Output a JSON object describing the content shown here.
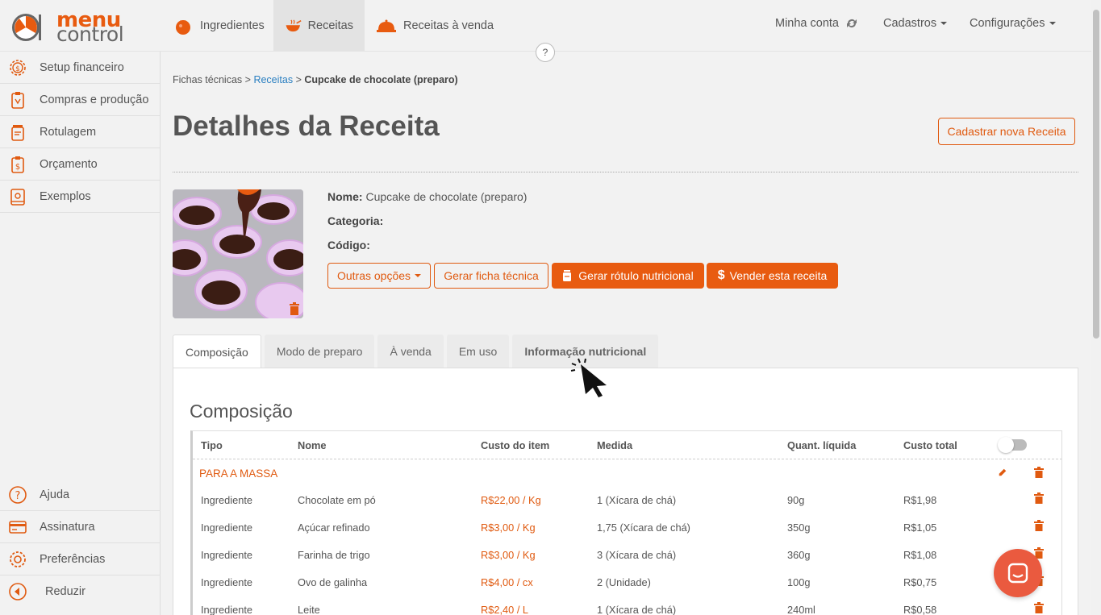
{
  "brand": {
    "line1": "menu",
    "line2": "control",
    "accent": "#e85b10"
  },
  "topnav": {
    "items": [
      {
        "label": "Ingredientes",
        "icon": "tomato-icon"
      },
      {
        "label": "Receitas",
        "icon": "bowl-icon",
        "active": true
      },
      {
        "label": "Receitas à venda",
        "icon": "cloche-icon"
      }
    ],
    "account": "Minha conta",
    "cadastros": "Cadastros",
    "config": "Configurações",
    "help": "?"
  },
  "sidebar": {
    "items": [
      {
        "label": "Setup financeiro",
        "icon": "gear-dollar-icon"
      },
      {
        "label": "Compras e produção",
        "icon": "clipboard-icon"
      },
      {
        "label": "Rotulagem",
        "icon": "jar-icon"
      },
      {
        "label": "Orçamento",
        "icon": "clipboard-dollar-icon"
      },
      {
        "label": "Exemplos",
        "icon": "book-icon"
      }
    ],
    "bottom": [
      {
        "label": "Ajuda",
        "icon": "question-icon"
      },
      {
        "label": "Assinatura",
        "icon": "card-icon"
      },
      {
        "label": "Preferências",
        "icon": "gear-icon"
      },
      {
        "label": "Reduzir",
        "icon": "collapse-icon"
      }
    ]
  },
  "breadcrumb": {
    "root": "Fichas técnicas",
    "sep": ">",
    "parent": "Receitas",
    "current": "Cupcake de chocolate (preparo)"
  },
  "page": {
    "title": "Detalhes da Receita",
    "new_button": "Cadastrar nova Receita"
  },
  "recipe": {
    "name_label": "Nome:",
    "name": "Cupcake de chocolate (preparo)",
    "category_label": "Categoria:",
    "category": "",
    "code_label": "Código:",
    "code": ""
  },
  "actions": {
    "other_options": "Outras opções",
    "gen_sheet": "Gerar ficha técnica",
    "gen_label": "Gerar rótulo nutricional",
    "sell": "Vender esta receita"
  },
  "tabs": [
    "Composição",
    "Modo de preparo",
    "À venda",
    "Em uso",
    "Informação nutricional"
  ],
  "composition": {
    "title": "Composição",
    "headers": [
      "Tipo",
      "Nome",
      "Custo do item",
      "Medida",
      "Quant. líquida",
      "Custo total"
    ],
    "group": "PARA A MASSA",
    "rows": [
      {
        "tipo": "Ingrediente",
        "nome": "Chocolate em pó",
        "custo": "R$22,00 / Kg",
        "medida": "1 (Xícara de chá)",
        "quant": "90g",
        "total": "R$1,98"
      },
      {
        "tipo": "Ingrediente",
        "nome": "Açúcar refinado",
        "custo": "R$3,00 / Kg",
        "medida": "1,75 (Xícara de chá)",
        "quant": "350g",
        "total": "R$1,05"
      },
      {
        "tipo": "Ingrediente",
        "nome": "Farinha de trigo",
        "custo": "R$3,00 / Kg",
        "medida": "3 (Xícara de chá)",
        "quant": "360g",
        "total": "R$1,08"
      },
      {
        "tipo": "Ingrediente",
        "nome": "Ovo de galinha",
        "custo": "R$4,00 / cx",
        "medida": "2 (Unidade)",
        "quant": "100g",
        "total": "R$0,75"
      },
      {
        "tipo": "Ingrediente",
        "nome": "Leite",
        "custo": "R$2,40 / L",
        "medida": "1 (Xícara de chá)",
        "quant": "240ml",
        "total": "R$0,58"
      }
    ]
  }
}
